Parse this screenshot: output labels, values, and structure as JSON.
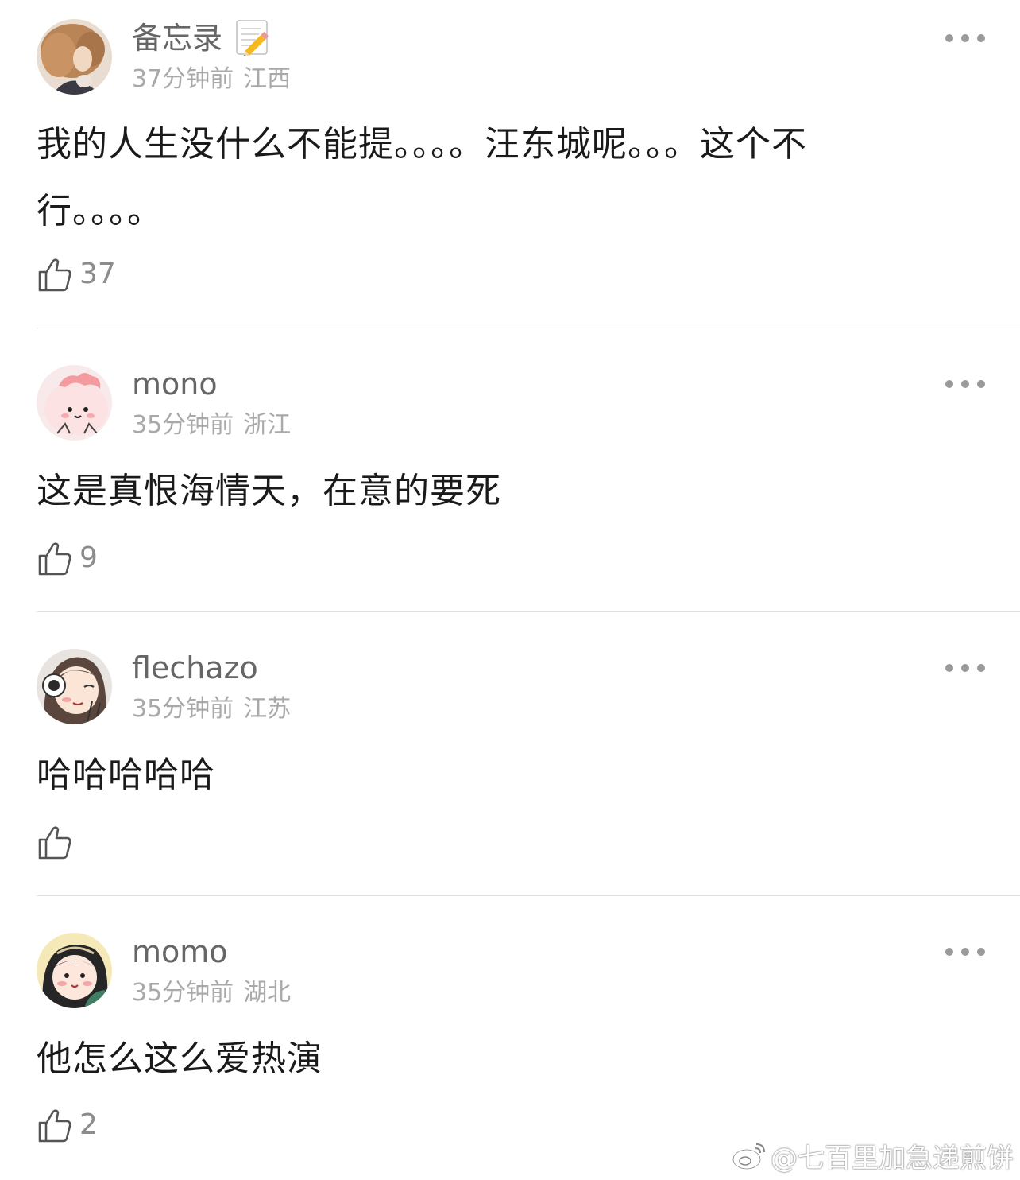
{
  "comments": [
    {
      "username": "备忘录",
      "time": "37分钟前",
      "location": "江西",
      "text": "我的人生没什么不能提。。。。汪东城呢。。。这个不行。。。。",
      "likes": "37",
      "avatar_icon": "curly-hair-woman-avatar"
    },
    {
      "username": "mono",
      "time": "35分钟前",
      "location": "浙江",
      "text": "这是真恨海情天，在意的要死",
      "likes": "9",
      "avatar_icon": "pink-blob-character-avatar"
    },
    {
      "username": "flechazo",
      "time": "35分钟前",
      "location": "江苏",
      "text": "哈哈哈哈哈",
      "likes": "",
      "avatar_icon": "cartoon-girl-peace-sign-avatar"
    },
    {
      "username": "momo",
      "time": "35分钟前",
      "location": "湖北",
      "text": "他怎么这么爱热演",
      "likes": "2",
      "avatar_icon": "cartoon-girl-headband-avatar"
    }
  ],
  "watermark": {
    "text": "@七百里加急递煎饼",
    "icon": "weibo-logo-icon"
  },
  "colors": {
    "username": "#666666",
    "meta": "#a9a9a9",
    "body": "#1a1a1a",
    "divider": "#e3e3e3"
  }
}
